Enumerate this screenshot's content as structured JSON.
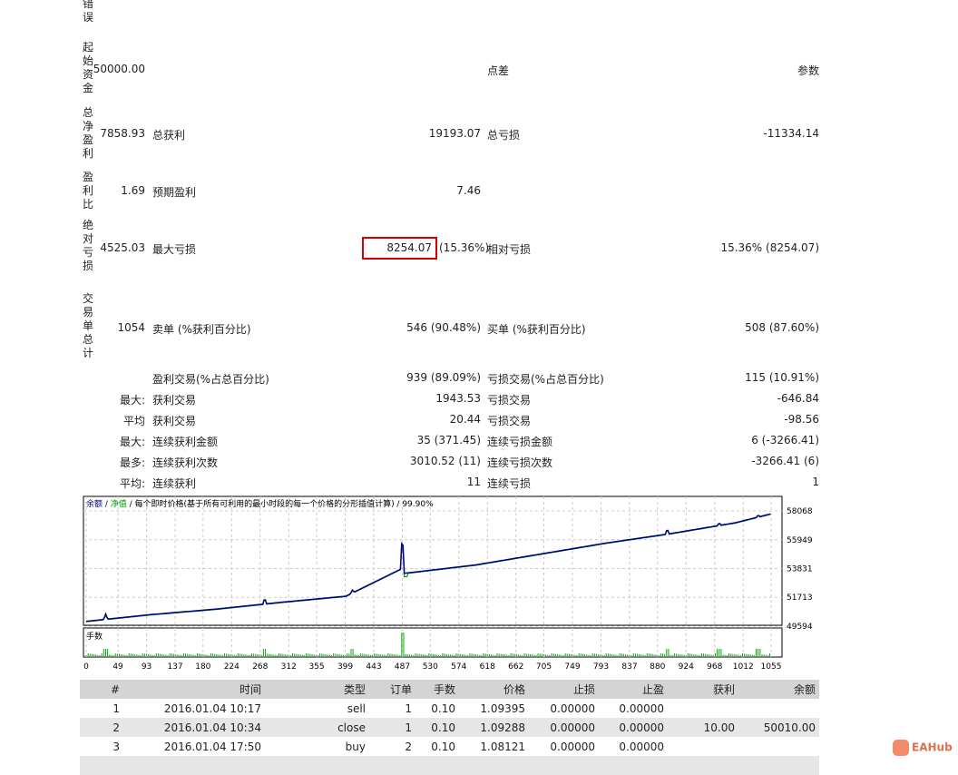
{
  "stats": {
    "error_label": "错误",
    "initial_deposit_label": "起始资金",
    "initial_deposit": "50000.00",
    "spread_label": "点差",
    "params_label": "参数",
    "net_profit_label": "总净盈利",
    "net_profit": "7858.93",
    "gross_profit_label": "总获利",
    "gross_profit": "19193.07",
    "gross_loss_label": "总亏损",
    "gross_loss": "-11334.14",
    "profit_factor_label": "盈利比",
    "profit_factor": "1.69",
    "expected_payoff_label": "预期盈利",
    "expected_payoff": "7.46",
    "abs_drawdown_label": "绝对亏损",
    "abs_drawdown": "4525.03",
    "max_drawdown_label": "最大亏损",
    "max_drawdown": "8254.07",
    "max_drawdown_pct": "(15.36%)",
    "rel_drawdown_label": "相对亏损",
    "rel_drawdown": "15.36% (8254.07)",
    "total_trades_label": "交易单总计",
    "total_trades": "1054",
    "short_label": "卖单 (%获利百分比)",
    "short_value": "546 (90.48%)",
    "long_label": "买单 (%获利百分比)",
    "long_value": "508 (87.60%)",
    "rows": [
      {
        "prefix": "",
        "l1": "盈利交易(%占总百分比)",
        "v1": "939 (89.09%)",
        "l2": "亏损交易(%占总百分比)",
        "v2": "115 (10.91%)"
      },
      {
        "prefix": "最大:",
        "l1": "获利交易",
        "v1": "1943.53",
        "l2": "亏损交易",
        "v2": "-646.84"
      },
      {
        "prefix": "平均",
        "l1": "获利交易",
        "v1": "20.44",
        "l2": "亏损交易",
        "v2": "-98.56"
      },
      {
        "prefix": "最大:",
        "l1": "连续获利金额",
        "v1": "35 (371.45)",
        "l2": "连续亏损金额",
        "v2": "6 (-3266.41)"
      },
      {
        "prefix": "最多:",
        "l1": "连续获利次数",
        "v1": "3010.52 (11)",
        "l2": "连续亏损次数",
        "v2": "-3266.41 (6)"
      },
      {
        "prefix": "平均:",
        "l1": "连续获利",
        "v1": "11",
        "l2": "连续亏损",
        "v2": "1"
      }
    ]
  },
  "chart_data": {
    "type": "line",
    "legend": {
      "balance": "余额",
      "sep1": " / ",
      "equity": "净值",
      "rest": " / 每个即时价格(基于所有可利用的最小时段的每一个价格的分形插值计算) / 99.90%"
    },
    "volume_label": "手数",
    "y_ticks": [
      "58068",
      "55949",
      "53831",
      "51713",
      "49594"
    ],
    "ylim": [
      49594,
      58068
    ],
    "x_ticks": [
      "0",
      "49",
      "93",
      "137",
      "180",
      "224",
      "268",
      "312",
      "355",
      "399",
      "443",
      "487",
      "530",
      "574",
      "618",
      "662",
      "705",
      "749",
      "793",
      "837",
      "880",
      "924",
      "968",
      "1012",
      "1055"
    ],
    "xlim": [
      0,
      1070
    ],
    "balance": [
      [
        0,
        49950
      ],
      [
        100,
        50450
      ],
      [
        200,
        50850
      ],
      [
        300,
        51350
      ],
      [
        400,
        51800
      ],
      [
        485,
        53800
      ],
      [
        490,
        53480
      ],
      [
        600,
        54100
      ],
      [
        700,
        54900
      ],
      [
        800,
        55700
      ],
      [
        900,
        56400
      ],
      [
        1000,
        57200
      ],
      [
        1055,
        57858
      ]
    ],
    "spikes": [
      [
        30,
        400
      ],
      [
        275,
        450
      ],
      [
        410,
        220
      ],
      [
        487,
        2900
      ],
      [
        895,
        400
      ],
      [
        975,
        200
      ],
      [
        1035,
        150
      ]
    ],
    "colors": {
      "balance": "#00008b",
      "equity": "#00a000",
      "volume": "#00aa00"
    }
  },
  "table": {
    "headers": [
      "#",
      "时间",
      "类型",
      "订单",
      "手数",
      "价格",
      "止损",
      "止盈",
      "获利",
      "余额"
    ],
    "rows": [
      [
        "1",
        "2016.01.04 10:17",
        "sell",
        "1",
        "0.10",
        "1.09395",
        "0.00000",
        "0.00000",
        "",
        ""
      ],
      [
        "2",
        "2016.01.04 10:34",
        "close",
        "1",
        "0.10",
        "1.09288",
        "0.00000",
        "0.00000",
        "10.00",
        "50010.00"
      ],
      [
        "3",
        "2016.01.04 17:50",
        "buy",
        "2",
        "0.10",
        "1.08121",
        "0.00000",
        "0.00000",
        "",
        ""
      ]
    ]
  },
  "watermark": "EAHub"
}
